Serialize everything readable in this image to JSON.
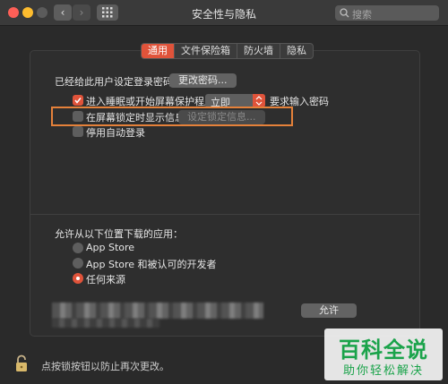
{
  "window": {
    "title": "安全性与隐私",
    "search_placeholder": "搜索"
  },
  "tabs": [
    {
      "label": "通用",
      "active": true
    },
    {
      "label": "文件保险箱",
      "active": false
    },
    {
      "label": "防火墙",
      "active": false
    },
    {
      "label": "隐私",
      "active": false
    }
  ],
  "general": {
    "password_set_label": "已经给此用户设定登录密码",
    "change_password_button": "更改密码...",
    "require_password": {
      "checked": true,
      "prefix": "进入睡眠或开始屏幕保护程序",
      "select_value": "立即",
      "suffix": "要求输入密码"
    },
    "show_message": {
      "checked": false,
      "label": "在屏幕锁定时显示信息",
      "button": "设定锁定信息..."
    },
    "disable_auto_login": {
      "checked": false,
      "label": "停用自动登录"
    }
  },
  "downloads": {
    "heading": "允许从以下位置下载的应用：",
    "options": [
      {
        "label": "App Store",
        "selected": false
      },
      {
        "label": "App Store 和被认可的开发者",
        "selected": false
      },
      {
        "label": "任何来源",
        "selected": true
      }
    ],
    "allow_button": "允许"
  },
  "footer": {
    "lock_text": "点按锁按钮以防止再次更改。"
  },
  "watermark": {
    "title": "百科全说",
    "subtitle": "助你轻松解决"
  },
  "colors": {
    "accent": "#e0533a",
    "highlight_box": "#e5813a",
    "watermark": "#1aa34a"
  },
  "icons": [
    "back-chevron-icon",
    "forward-chevron-icon",
    "grid-icon",
    "search-icon",
    "checkmark-icon",
    "stepper-arrows-icon",
    "lock-icon"
  ]
}
